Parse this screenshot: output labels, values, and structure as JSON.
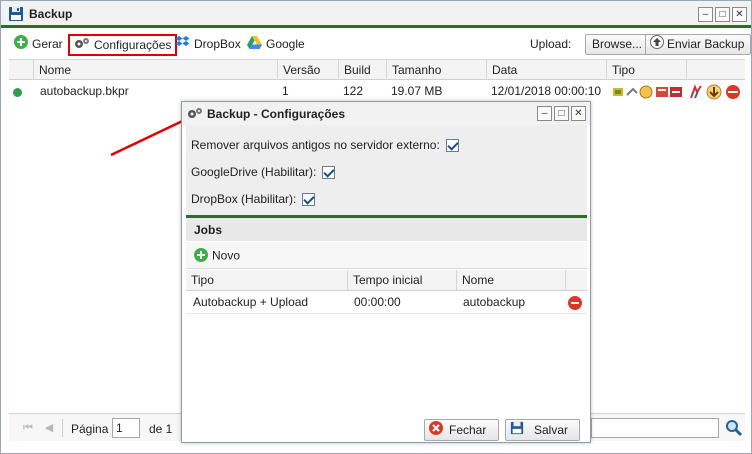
{
  "window": {
    "title": "Backup"
  },
  "toolbar": {
    "gerar": "Gerar",
    "configuracoes": "Configurações",
    "dropbox": "DropBox",
    "google": "Google",
    "upload_label": "Upload:",
    "browse": "Browse...",
    "enviar": "Enviar Backup"
  },
  "grid": {
    "columns": [
      "Nome",
      "Versão",
      "Build",
      "Tamanho",
      "Data",
      "Tipo"
    ],
    "rows": [
      {
        "nome": "autobackup.bkpr",
        "versao": "1",
        "build": "122",
        "tamanho": "19.07 MB",
        "data": "12/01/2018 00:00:10"
      }
    ]
  },
  "pager": {
    "pagina_label": "Página",
    "page": "1",
    "de_label": "de 1"
  },
  "dialog": {
    "title": "Backup - Configurações",
    "options": [
      {
        "label": "Remover arquivos antigos no servidor externo:",
        "checked": true
      },
      {
        "label": "GoogleDrive (Habilitar):",
        "checked": true
      },
      {
        "label": "DropBox (Habilitar):",
        "checked": true
      }
    ],
    "jobs_title": "Jobs",
    "novo": "Novo",
    "jobs_columns": [
      "Tipo",
      "Tempo inicial",
      "Nome"
    ],
    "jobs_rows": [
      {
        "tipo": "Autobackup + Upload",
        "tempo": "00:00:00",
        "nome": "autobackup"
      }
    ],
    "fechar": "Fechar",
    "salvar": "Salvar"
  },
  "colors": {
    "accent_green": "#2e6b2e",
    "highlight_red": "#e00000",
    "status_dot": "#2e9e4f"
  }
}
